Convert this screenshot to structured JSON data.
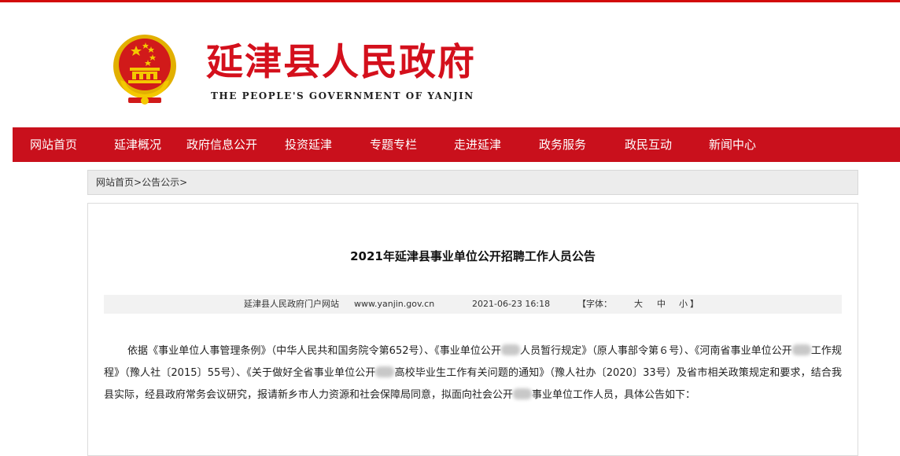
{
  "header": {
    "title": "延津县人民政府",
    "subtitle": "THE PEOPLE'S GOVERNMENT OF YANJIN",
    "emblem_icon": "national-emblem-icon"
  },
  "nav": {
    "items": [
      {
        "label": "网站首页"
      },
      {
        "label": "延津概况"
      },
      {
        "label": "政府信息公开"
      },
      {
        "label": "投资延津"
      },
      {
        "label": "专题专栏"
      },
      {
        "label": "走进延津"
      },
      {
        "label": "政务服务"
      },
      {
        "label": "政民互动"
      },
      {
        "label": "新闻中心"
      }
    ]
  },
  "breadcrumb": {
    "home": "网站首页",
    "sep1": " > ",
    "current": "公告公示",
    "sep2": " >"
  },
  "article": {
    "title": "2021年延津县事业单位公开招聘工作人员公告",
    "source": "延津县人民政府门户网站",
    "site_url": "www.yanjin.gov.cn",
    "date": "2021-06-23 16:18",
    "font_label": "【字体：",
    "font_large": "大",
    "font_medium": "中",
    "font_small": "小",
    "font_close": "】",
    "para_a": "依据《事业单位人事管理条例》（中华人民共和国务院令第652号）、《事业单位公开",
    "para_b": "人员暂行规定》（原人事部令第６号）、《河南省事业单位公开",
    "para_c": "工作规程》（豫人社〔2015〕55号）、《关于做好全省事业单位公开",
    "para_d": "高校毕业生工作有关问题的通知》（豫人社办〔2020〕33号）及省市相关政策规定和要求，结合我县实际，经县政府常务会议研究，报请新乡市人力资源和社会保障局同意，拟面向社会公开",
    "para_e": "事业单位工作人员，具体公告如下："
  },
  "colors": {
    "brand_red": "#c9101c",
    "title_red": "#d4101c",
    "gold": "#f2c200"
  }
}
